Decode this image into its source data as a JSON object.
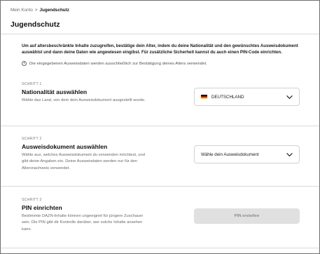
{
  "breadcrumb": {
    "parent": "Mein Konto",
    "separator": ">",
    "current": "Jugendschutz"
  },
  "page": {
    "title": "Jugendschutz",
    "intro": "Um auf altersbeschränkte Inhalte zuzugreifen, bestätige dein Alter, indem du deine Nationalität und den gewünschtes Ausweisdokument auswählst und dann deine Daten wie angewiesen eingibst. Für zusätzliche Sicherheit kannst du auch einen PIN-Code einrichten.",
    "info_icon": "info-circle-icon",
    "info_text": "Die eingegebenen Ausweisdaten werden ausschließlich zur Bestätigung deines Alters verwendet."
  },
  "steps": [
    {
      "number": "SCHRITT 1",
      "title": "Nationalität auswählen",
      "description": "Wähle das Land, von dem dein Ausweisdokument ausgestellt wurde.",
      "control": {
        "type": "select",
        "value": "DEUTSCHLAND",
        "flag_icon": "germany-flag-icon",
        "flag_colors": [
          "#000000",
          "#dd0000",
          "#ffce00"
        ]
      }
    },
    {
      "number": "SCHRITT 2",
      "title": "Ausweisdokument auswählen",
      "description": "Wähle aus, welches Ausweisdokument du verwenden möchtest, und gibt deine Angaben ein. Deine Ausweisdaten werden nur für den Altersnachweis verwendet.",
      "control": {
        "type": "select",
        "value": "Wähle dein Ausweisdokument"
      }
    },
    {
      "number": "SCHRITT 3",
      "title": "PIN einrichten",
      "description": "Bestimmte DAZN-Inhalte können ungeeignet für jüngere Zuschauer sein. Die PIN gibt dir Kontrolle darüber, wer solche Inhalte ansehen kann.",
      "control": {
        "type": "button",
        "label": "PIN erstellen",
        "disabled": true
      }
    }
  ],
  "colors": {
    "divider": "#d9d9d9",
    "button_disabled_bg": "#e0e0e0",
    "button_disabled_text": "#8a8a8a"
  }
}
